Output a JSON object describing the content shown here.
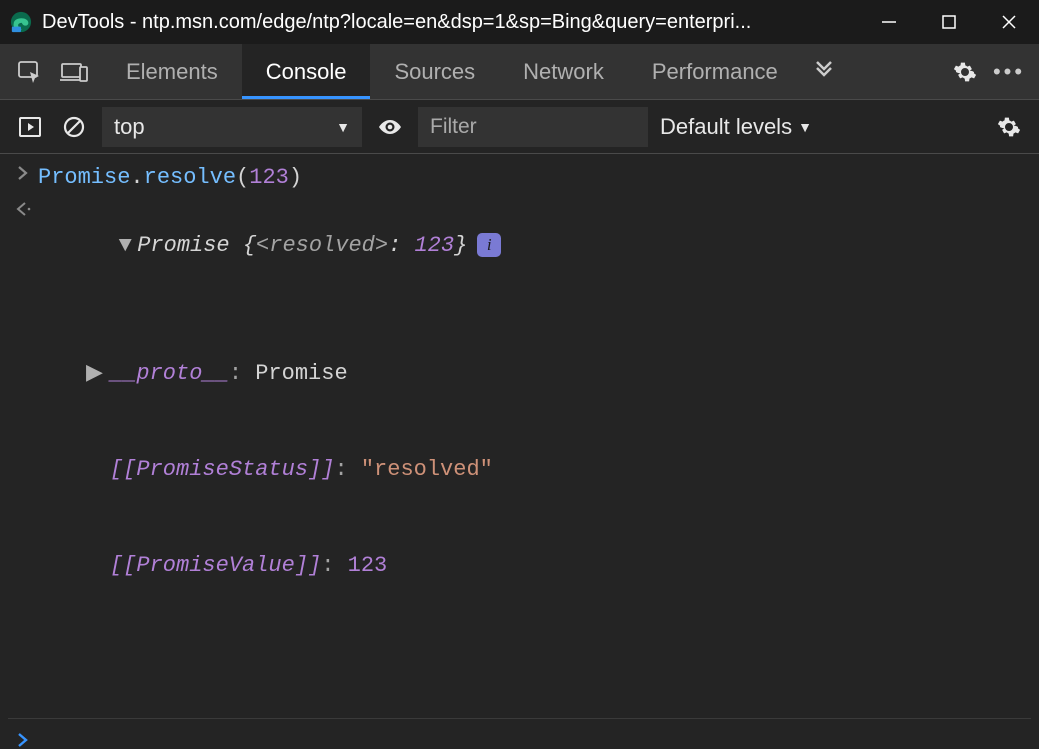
{
  "window": {
    "title": "DevTools - ntp.msn.com/edge/ntp?locale=en&dsp=1&sp=Bing&query=enterpri..."
  },
  "tabs": {
    "elements": "Elements",
    "console": "Console",
    "sources": "Sources",
    "network": "Network",
    "performance": "Performance"
  },
  "toolbar": {
    "context": "top",
    "filter_placeholder": "Filter",
    "levels": "Default levels"
  },
  "console": {
    "input_line": {
      "fn": "Promise",
      "method": "resolve",
      "arg": "123"
    },
    "output_line": {
      "class_name": "Promise",
      "resolved_label": "<resolved>",
      "resolved_value": "123",
      "info": "i"
    },
    "expanded": {
      "proto_label": "__proto__",
      "proto_value": "Promise",
      "status_label": "[[PromiseStatus]]",
      "status_value": "\"resolved\"",
      "value_label": "[[PromiseValue]]",
      "value_value": "123"
    }
  }
}
